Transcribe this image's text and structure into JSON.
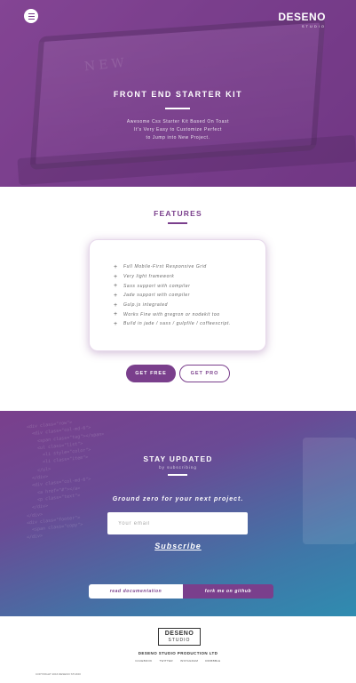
{
  "hero": {
    "brand_name": "DESENO",
    "brand_sub": "STUDIO",
    "screen_text": "NEW",
    "title": "FRONT END STARTER KIT",
    "description": [
      "Awesome Css Starter Kit Based On Toast",
      "It's Very Easy to Customize Perfect",
      "to Jump into New Project."
    ]
  },
  "features": {
    "title": "FEATURES",
    "items": [
      "Full Mobile-First Responsive Grid",
      "Very light framework",
      "Sass support with compiler",
      "Jade support with compiler",
      "Gulp.js integrated",
      "Works Fine with gregron or nodekit too",
      "Build in jade / sass / gulpfile / coffeescript."
    ],
    "btn_free": "GET FREE",
    "btn_pro": "GET PRO"
  },
  "updates": {
    "title": "STAY UPDATED",
    "subtitle": "by subscribing",
    "tagline": "Ground zero for your next project.",
    "email_placeholder": "Your email",
    "subscribe": "Subscribe",
    "doc_btn": "read documentation",
    "fork_btn": "fork me on github"
  },
  "footer": {
    "logo_name": "DESENO",
    "logo_sub": "STUDIO",
    "company": "DESENO STUDIO PRODUCTION LTD",
    "links": [
      "FACEBOOK",
      "TWITTER",
      "INSTAGRAM",
      "DRIBBBLE"
    ],
    "copyright": "COPYRIGHT 2016 DESENO STUDIO"
  },
  "colors": {
    "accent": "#7a3f8c",
    "teal": "#2f8cb0"
  }
}
